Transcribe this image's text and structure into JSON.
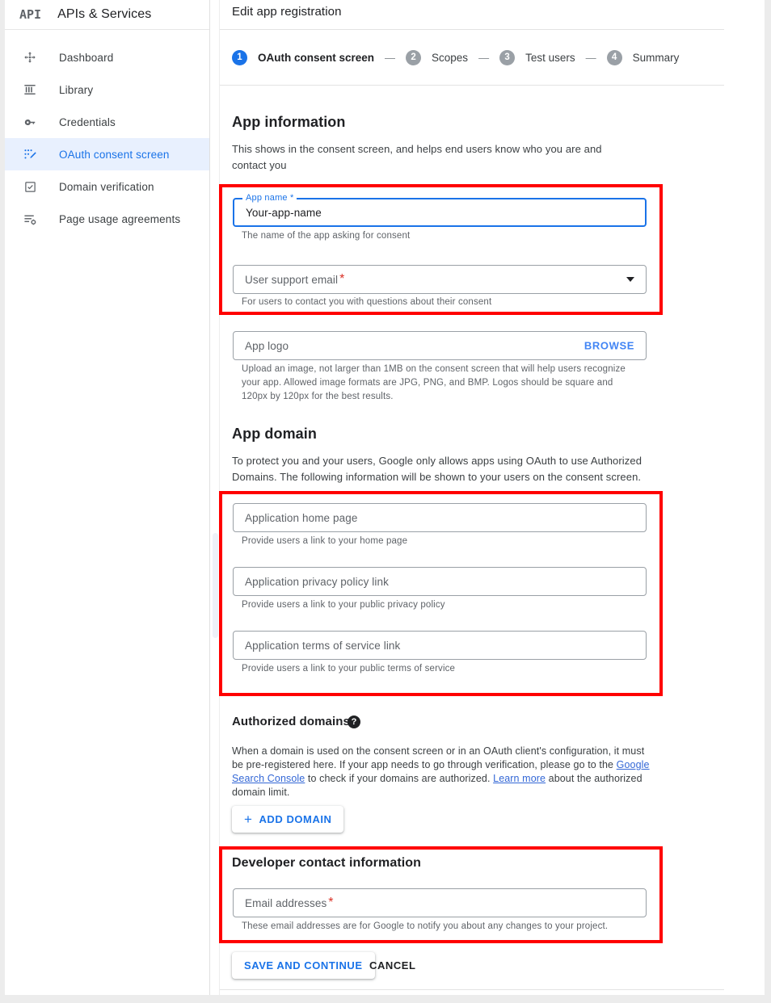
{
  "brand": {
    "logo_text": "API",
    "title": "APIs & Services"
  },
  "sidebar": {
    "items": [
      {
        "label": "Dashboard",
        "icon": "dashboard-icon"
      },
      {
        "label": "Library",
        "icon": "library-icon"
      },
      {
        "label": "Credentials",
        "icon": "key-icon"
      },
      {
        "label": "OAuth consent screen",
        "icon": "consent-screen-icon"
      },
      {
        "label": "Domain verification",
        "icon": "checkbox-icon"
      },
      {
        "label": "Page usage agreements",
        "icon": "list-settings-icon"
      }
    ],
    "active_index": 3,
    "active_color": "#1a73e8",
    "active_background": "#e8f0fe"
  },
  "header": {
    "title": "Edit app registration"
  },
  "stepper": {
    "separator": "—",
    "steps": [
      {
        "num": "1",
        "label": "OAuth consent screen",
        "current": true
      },
      {
        "num": "2",
        "label": "Scopes",
        "current": false
      },
      {
        "num": "3",
        "label": "Test users",
        "current": false
      },
      {
        "num": "4",
        "label": "Summary",
        "current": false
      }
    ]
  },
  "app_information": {
    "heading": "App information",
    "description": "This shows in the consent screen, and helps end users know who you are and contact you",
    "app_name": {
      "label": "App name *",
      "value": "Your-app-name",
      "helper": "The name of the app asking for consent"
    },
    "user_support_email": {
      "placeholder": "User support email",
      "required_mark": "*",
      "helper": "For users to contact you with questions about their consent"
    },
    "app_logo": {
      "placeholder": "App logo",
      "browse_label": "BROWSE",
      "helper": "Upload an image, not larger than 1MB on the consent screen that will help users recognize your app. Allowed image formats are JPG, PNG, and BMP. Logos should be square and 120px by 120px for the best results."
    }
  },
  "app_domain": {
    "heading": "App domain",
    "description": "To protect you and your users, Google only allows apps using OAuth to use Authorized Domains. The following information will be shown to your users on the consent screen.",
    "fields": [
      {
        "placeholder": "Application home page",
        "helper": "Provide users a link to your home page"
      },
      {
        "placeholder": "Application privacy policy link",
        "helper": "Provide users a link to your public privacy policy"
      },
      {
        "placeholder": "Application terms of service link",
        "helper": "Provide users a link to your public terms of service"
      }
    ]
  },
  "authorized_domains": {
    "heading": "Authorized domains",
    "help_glyph": "?",
    "desc_part1": "When a domain is used on the consent screen or in an OAuth client's configuration, it must be pre-registered here. If your app needs to go through verification, please go to the ",
    "link1": "Google Search Console",
    "desc_part2": " to check if your domains are authorized. ",
    "link2": "Learn more",
    "desc_part3": " about the authorized domain limit.",
    "add_domain_label": "ADD DOMAIN",
    "add_domain_plus": "+"
  },
  "developer_contact": {
    "heading": "Developer contact information",
    "email": {
      "placeholder": "Email addresses",
      "required_mark": "*",
      "helper": "These email addresses are for Google to notify you about any changes to your project."
    }
  },
  "actions": {
    "save_label": "SAVE AND CONTINUE",
    "cancel_label": "CANCEL"
  },
  "annotation": {
    "color": "#ff0000"
  }
}
